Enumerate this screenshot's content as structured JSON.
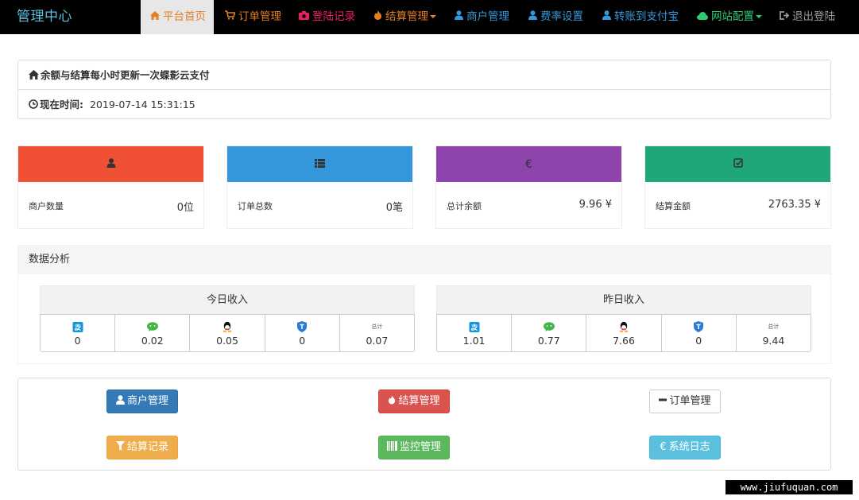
{
  "navbar": {
    "brand": "管理中心",
    "items": [
      {
        "label": "平台首页",
        "icon": "home-icon",
        "color": "#e67e22",
        "active": true
      },
      {
        "label": "订单管理",
        "icon": "cart-icon",
        "color": "#e67e22"
      },
      {
        "label": "登陆记录",
        "icon": "camera-icon",
        "color": "#e91e63"
      },
      {
        "label": "结算管理",
        "icon": "fire-icon",
        "color": "#e67e22",
        "dropdown": true
      },
      {
        "label": "商户管理",
        "icon": "user-icon",
        "color": "#3498db"
      },
      {
        "label": "费率设置",
        "icon": "user-icon",
        "color": "#3498db"
      },
      {
        "label": "转账到支付宝",
        "icon": "user-icon",
        "color": "#3498db"
      },
      {
        "label": "网站配置",
        "icon": "cloud-icon",
        "color": "#2ecc71",
        "dropdown": true
      },
      {
        "label": "退出登陆",
        "icon": "logout-icon",
        "color": "#999999"
      }
    ]
  },
  "info": {
    "notice": "余额与结算每小时更新一次蝶影云支付",
    "time_label": "现在时间:",
    "time_value": "2019-07-14 15:31:15"
  },
  "stats": [
    {
      "label": "商户数量",
      "value": "0位",
      "color": "#f05033",
      "icon": "user-icon"
    },
    {
      "label": "订单总数",
      "value": "0笔",
      "color": "#3597db",
      "icon": "list-icon"
    },
    {
      "label": "总计余额",
      "value": "9.96 ¥",
      "color": "#8e44ad",
      "icon": "euro-icon"
    },
    {
      "label": "结算金额",
      "value": "2763.35 ¥",
      "color": "#1fa67a",
      "icon": "check-icon"
    }
  ],
  "analysis": {
    "title": "数据分析",
    "today": {
      "title": "今日收入",
      "cells": [
        {
          "icon": "alipay-icon",
          "value": "0"
        },
        {
          "icon": "wechat-icon",
          "value": "0.02"
        },
        {
          "icon": "qq-icon",
          "value": "0.05"
        },
        {
          "icon": "tenpay-shield-icon",
          "value": "0"
        },
        {
          "icon": "total-icon",
          "icon_text": "总计",
          "value": "0.07"
        }
      ]
    },
    "yesterday": {
      "title": "昨日收入",
      "cells": [
        {
          "icon": "alipay-icon",
          "value": "1.01"
        },
        {
          "icon": "wechat-icon",
          "value": "0.77"
        },
        {
          "icon": "qq-icon",
          "value": "7.66"
        },
        {
          "icon": "tenpay-shield-icon",
          "value": "0"
        },
        {
          "icon": "total-icon",
          "icon_text": "总计",
          "value": "9.44"
        }
      ]
    }
  },
  "actions": [
    {
      "label": "商户管理",
      "icon": "user-icon",
      "color": "#337ab7"
    },
    {
      "label": "结算管理",
      "icon": "fire-icon",
      "color": "#d9534f"
    },
    {
      "label": "订单管理",
      "icon": "minus-icon",
      "color": "#ffffff"
    },
    {
      "label": "结算记录",
      "icon": "filter-icon",
      "color": "#f0ad4e"
    },
    {
      "label": "监控管理",
      "icon": "barcode-icon",
      "color": "#5cb85c"
    },
    {
      "label": "系统日志",
      "icon": "euro-icon",
      "color": "#5bc0de"
    }
  ],
  "watermark": "www.jiufuquan.com"
}
